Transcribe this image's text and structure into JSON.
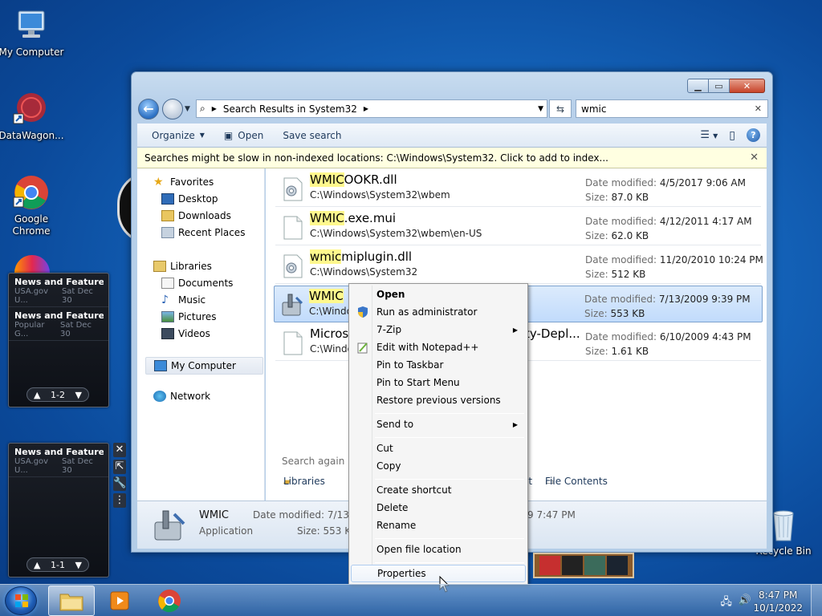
{
  "desktop": {
    "icons": [
      {
        "label": "My Computer"
      },
      {
        "label": "DataWagon..."
      },
      {
        "label": "Google Chrome"
      },
      {
        "label": "Recycle Bin"
      }
    ]
  },
  "gadgets": {
    "top": {
      "items": [
        {
          "title": "News and Features f...",
          "source": "USA.gov U...",
          "date": "Sat Dec 30"
        },
        {
          "title": "News and Features f...",
          "source": "Popular G...",
          "date": "Sat Dec 30"
        }
      ],
      "pager": "1-2"
    },
    "bottom": {
      "items": [
        {
          "title": "News and Features f...",
          "source": "USA.gov U...",
          "date": "Sat Dec 30"
        }
      ],
      "pager": "1-1"
    }
  },
  "explorer": {
    "address": {
      "segment": "Search Results in System32"
    },
    "search": {
      "value": "wmic"
    },
    "toolbar": {
      "organize": "Organize",
      "open": "Open",
      "save_search": "Save search"
    },
    "infobar": "Searches might be slow in non-indexed locations: C:\\Windows\\System32. Click to add to index...",
    "nav": {
      "favorites": "Favorites",
      "desktop": "Desktop",
      "downloads": "Downloads",
      "recent": "Recent Places",
      "libraries": "Libraries",
      "documents": "Documents",
      "music": "Music",
      "pictures": "Pictures",
      "videos": "Videos",
      "mycomputer": "My Computer",
      "network": "Network"
    },
    "results": [
      {
        "hl": "WMIC",
        "rest": "OOKR.dll",
        "path": "C:\\Windows\\System32\\wbem",
        "date_label": "Date modified:",
        "date": "4/5/2017 9:06 AM",
        "size_label": "Size:",
        "size": "87.0 KB"
      },
      {
        "hl": "WMIC",
        "rest": ".exe.mui",
        "path": "C:\\Windows\\System32\\wbem\\en-US",
        "date_label": "Date modified:",
        "date": "4/12/2011 4:17 AM",
        "size_label": "Size:",
        "size": "62.0 KB"
      },
      {
        "hl": "wmic",
        "rest": "miplugin.dll",
        "path": "C:\\Windows\\System32",
        "date_label": "Date modified:",
        "date": "11/20/2010 10:24 PM",
        "size_label": "Size:",
        "size": "512 KB"
      },
      {
        "hl": "WMIC",
        "rest": "",
        "path": "C:\\Windo",
        "date_label": "Date modified:",
        "date": "7/13/2009 9:39 PM",
        "size_label": "Size:",
        "size": "553 KB"
      },
      {
        "hl": "",
        "rest": "Microsc",
        "rest2": "ty-Depl...",
        "path": "C:\\Windo",
        "date_label": "Date modified:",
        "date": "6/10/2009 4:43 PM",
        "size_label": "Size:",
        "size": "1.61 KB"
      }
    ],
    "search_again": {
      "label": "Search again in:",
      "libraries": "Libraries",
      "internet": "et",
      "file_contents": "File Contents"
    },
    "details": {
      "name": "WMIC",
      "type": "Application",
      "date_label": "Date modified: 7/13/",
      "size_label": "Size: 553 KB",
      "created": "9 7:47 PM"
    }
  },
  "context_menu": {
    "items": [
      {
        "label": "Open",
        "bold": true
      },
      {
        "label": "Run as administrator"
      },
      {
        "label": "7-Zip",
        "submenu": true
      },
      {
        "label": "Edit with Notepad++"
      },
      {
        "label": "Pin to Taskbar"
      },
      {
        "label": "Pin to Start Menu"
      },
      {
        "label": "Restore previous versions"
      },
      {
        "label": "Send to",
        "submenu": true
      },
      {
        "label": "Cut"
      },
      {
        "label": "Copy"
      },
      {
        "label": "Create shortcut"
      },
      {
        "label": "Delete"
      },
      {
        "label": "Rename"
      },
      {
        "label": "Open file location"
      },
      {
        "label": "Properties",
        "hover": true
      }
    ]
  },
  "taskbar": {
    "time": "8:47 PM",
    "date": "10/1/2022"
  }
}
